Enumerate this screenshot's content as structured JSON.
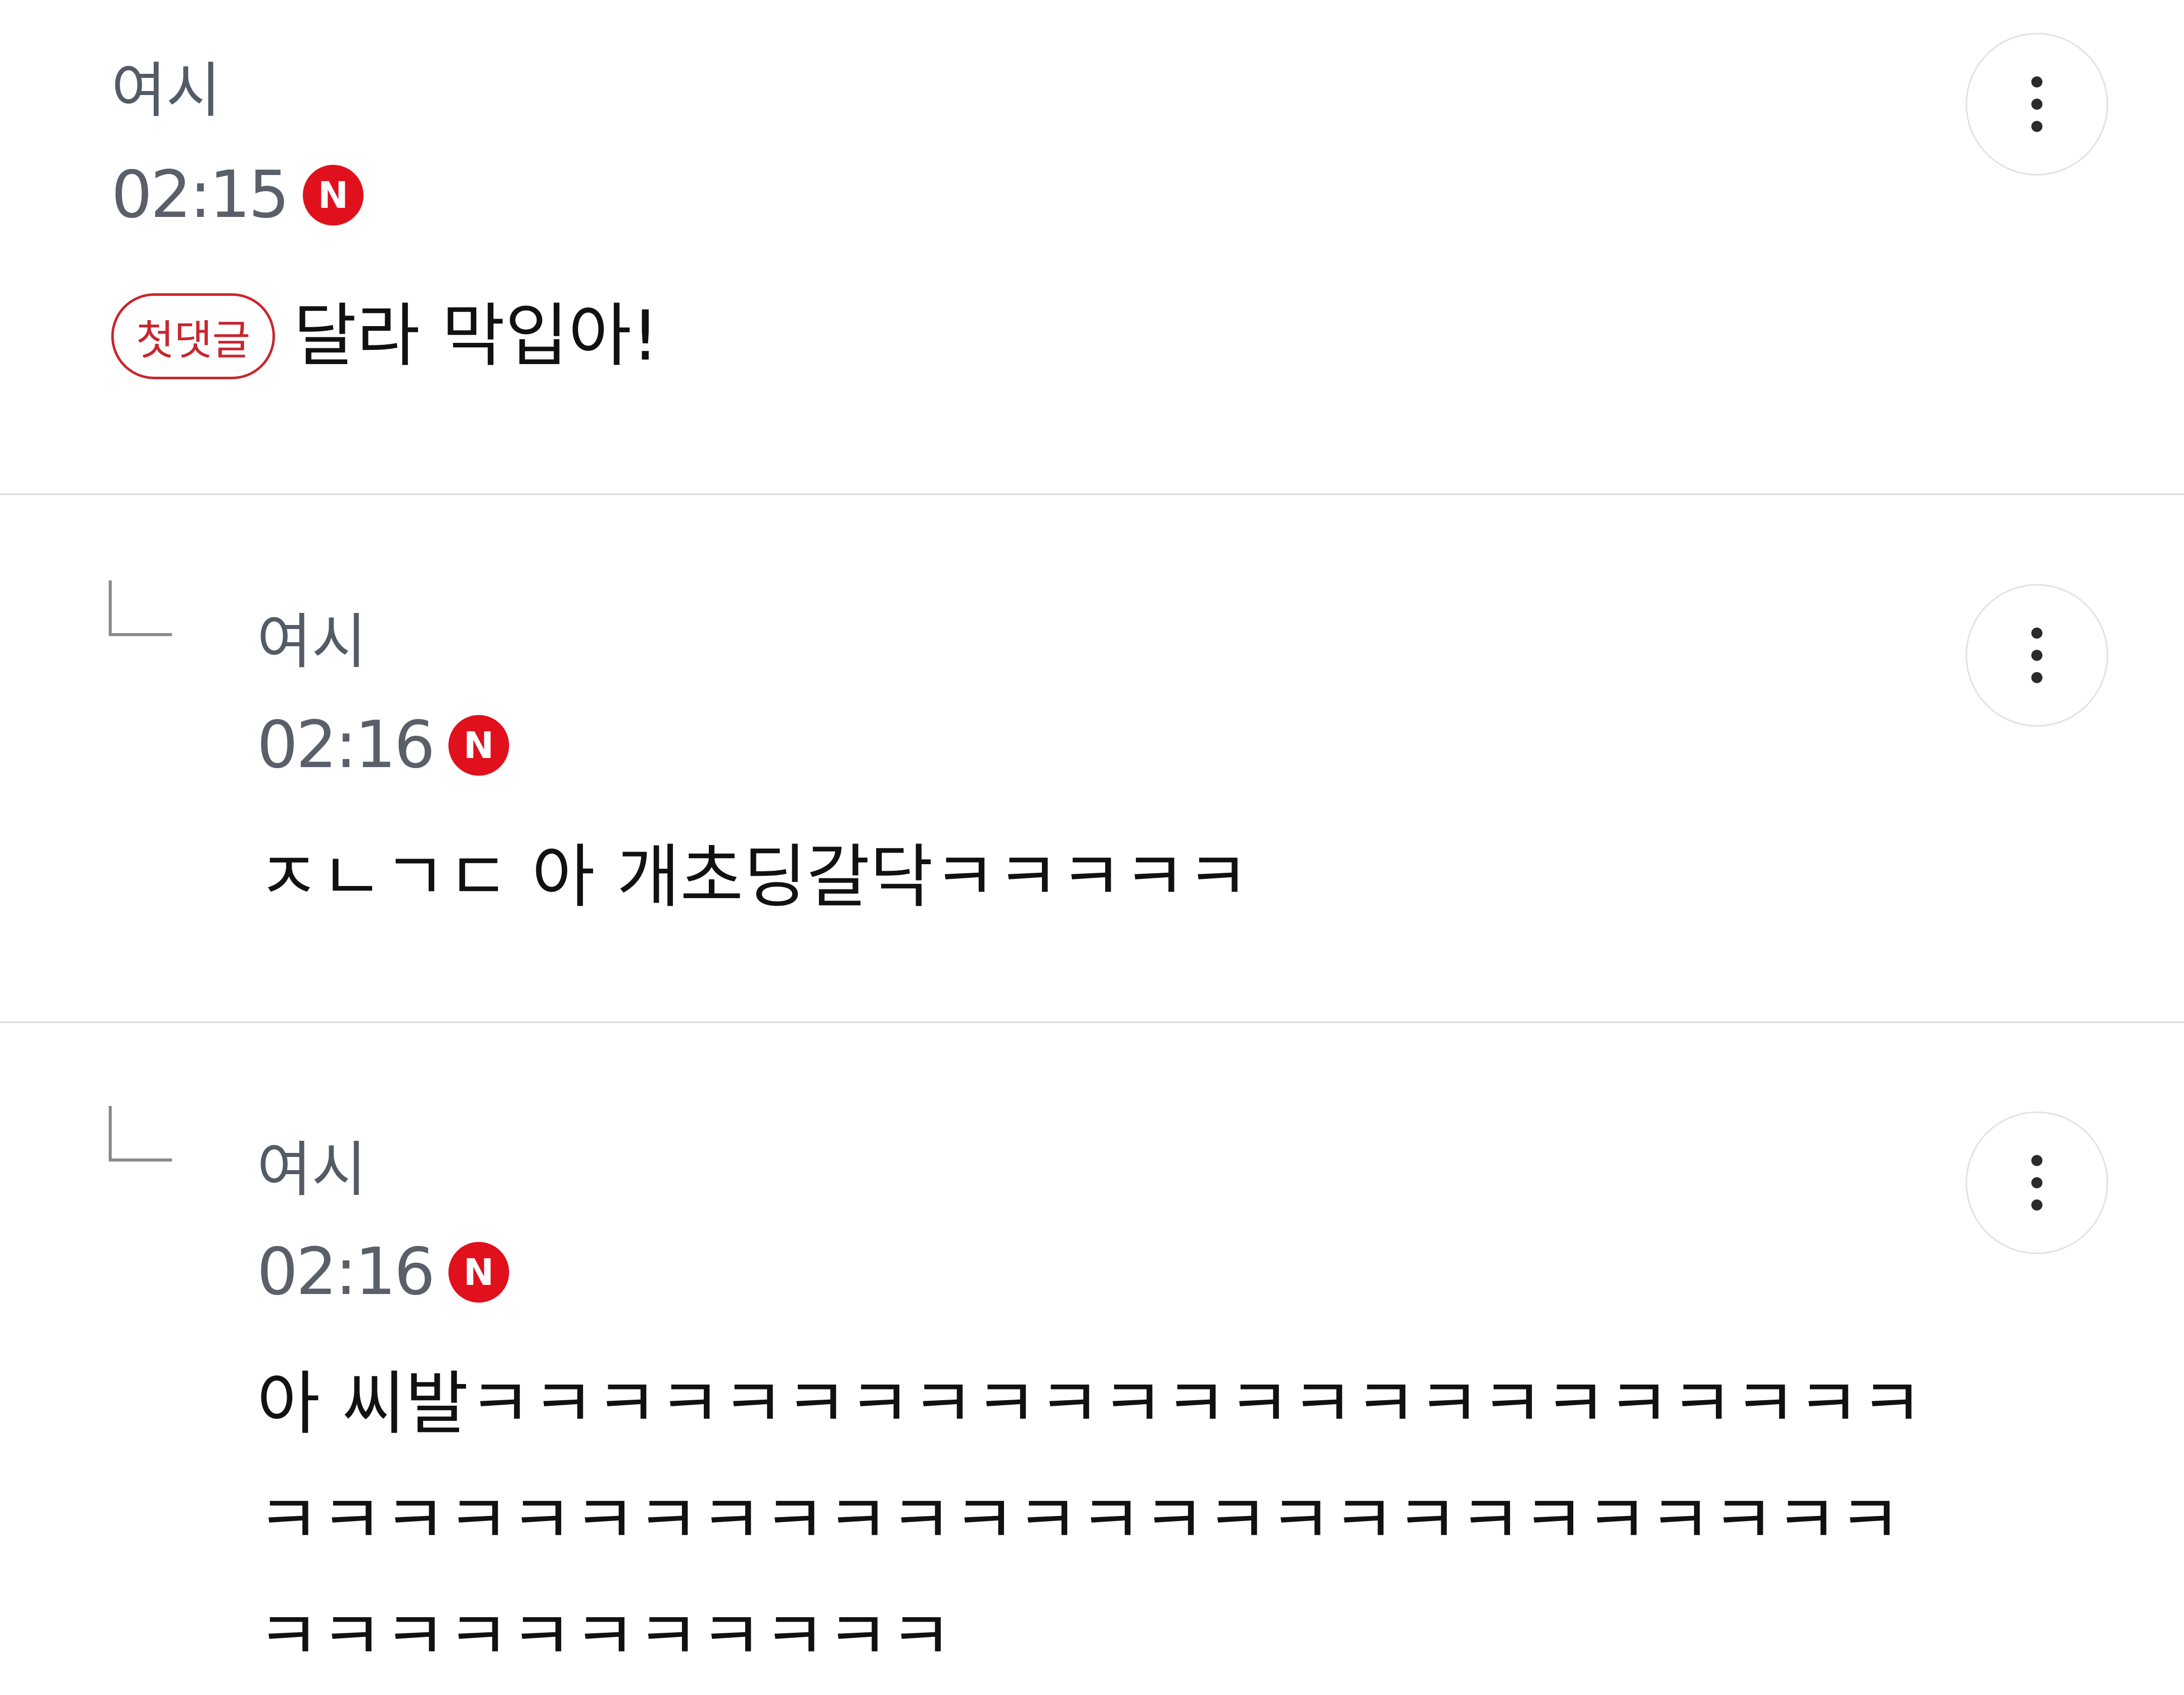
{
  "comments": [
    {
      "author": "여시",
      "time": "02:15",
      "new_badge": "N",
      "first_comment_badge": "첫댓글",
      "text": "달라 막입아!",
      "is_reply": false
    },
    {
      "author": "여시",
      "time": "02:16",
      "new_badge": "N",
      "text": "ㅈㄴㄱㄷ 아 개초딩갈닥ㅋㅋㅋㅋㅋ",
      "is_reply": true
    },
    {
      "author": "여시",
      "time": "02:16",
      "new_badge": "N",
      "text": "아 씨발ㅋㅋㅋㅋㅋㅋㅋㅋㅋㅋㅋㅋㅋㅋㅋㅋㅋㅋㅋㅋㅋㅋㅋㅋㅋㅋㅋㅋㅋㅋㅋㅋㅋㅋㅋㅋㅋㅋㅋㅋㅋㅋㅋㅋㅋㅋㅋㅋㅋㅋㅋㅋㅋㅋㅋㅋㅋㅋㅋㅋ",
      "is_reply": true
    }
  ],
  "icons": {
    "more": "more-vertical-icon",
    "reply": "reply-arrow-icon"
  },
  "colors": {
    "new_badge_bg": "#e0101c",
    "first_badge": "#c8262e",
    "divider": "#dedede",
    "meta_text": "#5a5f6a"
  }
}
